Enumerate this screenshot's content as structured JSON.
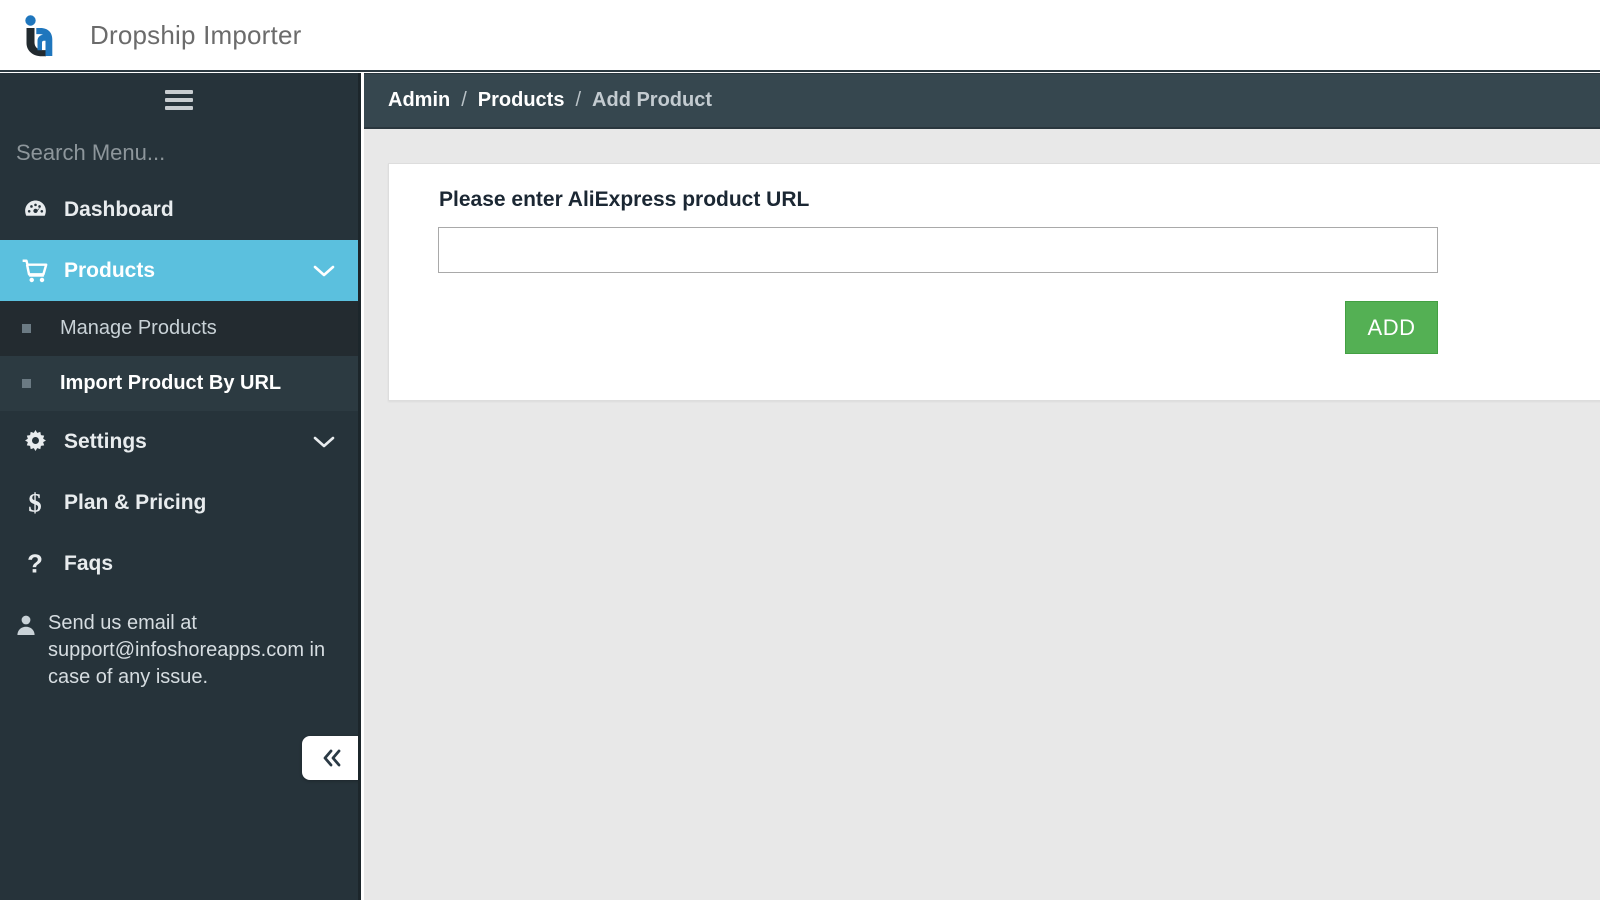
{
  "header": {
    "brand_title": "Dropship Importer",
    "logo_icon": "ia-monogram-logo",
    "logo_dark_color": "#222a2f",
    "logo_blue_color": "#1f76bd"
  },
  "sidebar": {
    "toggle_icon": "hamburger-icon",
    "search": {
      "placeholder": "Search Menu...",
      "value": ""
    },
    "items": [
      {
        "label": "Dashboard",
        "icon": "tachometer-icon",
        "active": false,
        "has_caret": false
      },
      {
        "label": "Products",
        "icon": "shopping-cart-icon",
        "active": true,
        "has_caret": true,
        "caret_icon": "chevron-down-icon"
      },
      {
        "label": "Settings",
        "icon": "gear-icon",
        "active": false,
        "has_caret": true,
        "caret_icon": "chevron-down-icon"
      },
      {
        "label": "Plan & Pricing",
        "icon": "dollar-sign-icon",
        "active": false,
        "has_caret": false
      },
      {
        "label": "Faqs",
        "icon": "question-mark-icon",
        "active": false,
        "has_caret": false
      }
    ],
    "submenu": [
      {
        "label": "Manage Products",
        "current": false
      },
      {
        "label": "Import Product By URL",
        "current": true
      }
    ],
    "support": {
      "icon": "user-icon",
      "text": "Send us email at support@infoshoreapps.com in case of any issue."
    },
    "collapse_button": {
      "icon": "double-chevron-left-icon",
      "glyph": "«"
    },
    "colors": {
      "background": "#26333a",
      "active": "#5bc0de",
      "submenu_current": "#2c3a41",
      "submenu_shaded": "#232b30"
    }
  },
  "breadcrumb": {
    "separator": "/",
    "items": [
      {
        "label": "Admin",
        "is_last": false
      },
      {
        "label": "Products",
        "is_last": false
      },
      {
        "label": "Add Product",
        "is_last": true
      }
    ]
  },
  "main": {
    "card": {
      "label": "Please enter AliExpress product URL",
      "input": {
        "value": "",
        "placeholder": ""
      },
      "add_button": {
        "label": "ADD",
        "color": "#54b054"
      }
    },
    "background_color": "#e8e8e8"
  }
}
